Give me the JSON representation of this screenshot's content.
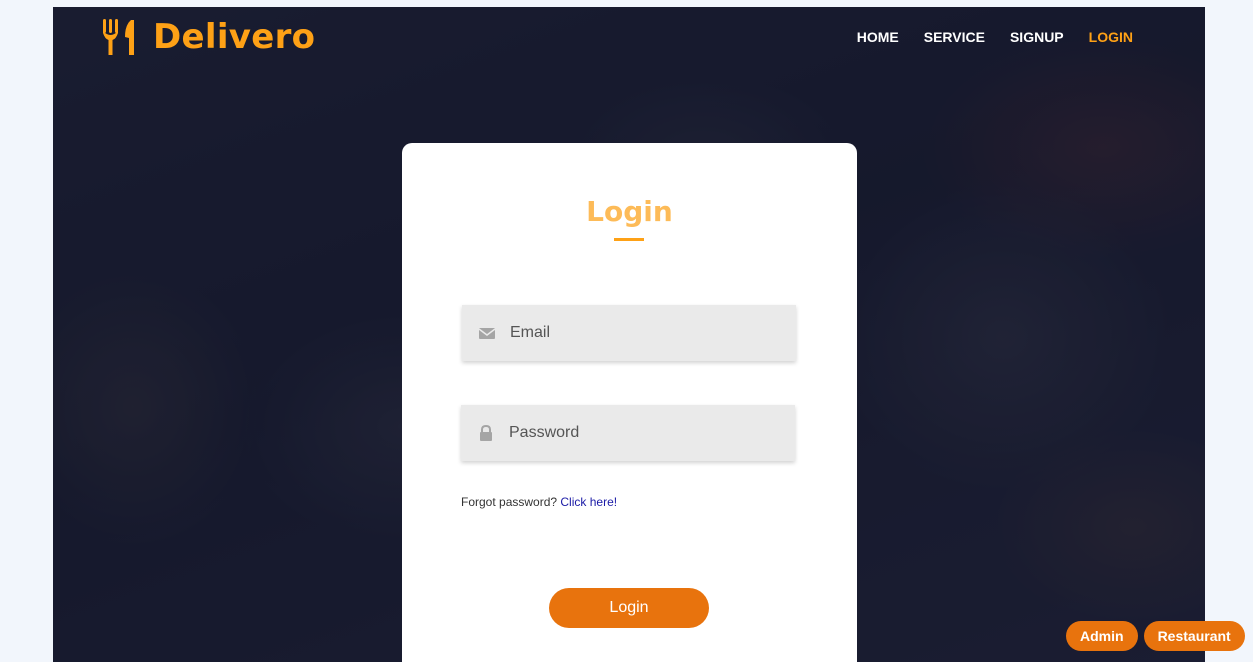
{
  "brand": {
    "name": "Delivero",
    "icon": "utensils-icon",
    "color": "#fea116"
  },
  "nav": {
    "items": [
      {
        "label": "HOME"
      },
      {
        "label": "SERVICE"
      },
      {
        "label": "SIGNUP"
      },
      {
        "label": "LOGIN",
        "active": true
      }
    ]
  },
  "login_form": {
    "title": "Login",
    "email": {
      "placeholder": "Email",
      "value": "",
      "icon": "envelope-icon"
    },
    "password": {
      "placeholder": "Password",
      "value": "",
      "icon": "lock-icon"
    },
    "forgot_text": "Forgot password?",
    "forgot_link": "Click here!",
    "submit_label": "Login"
  },
  "floating_buttons": {
    "admin_label": "Admin",
    "restaurant_label": "Restaurant"
  },
  "colors": {
    "accent": "#fea116",
    "button": "#e8730d",
    "link": "#1a1aa6"
  }
}
